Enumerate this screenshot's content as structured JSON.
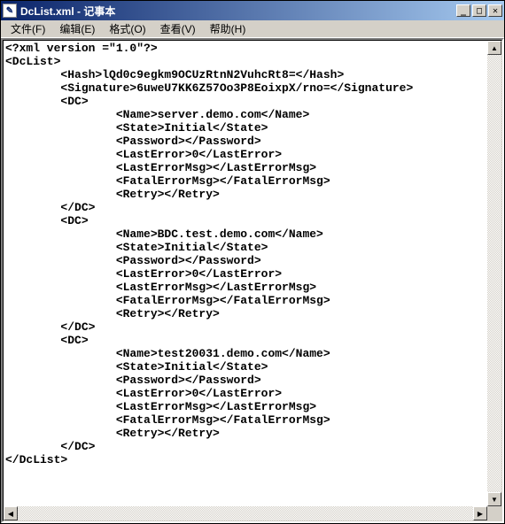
{
  "window": {
    "title": "DcList.xml - 记事本"
  },
  "menu": {
    "file": "文件(F)",
    "edit": "编辑(E)",
    "format": "格式(O)",
    "view": "查看(V)",
    "help": "帮助(H)"
  },
  "content": {
    "xml_declaration": "<?xml version =\"1.0\"?>",
    "root_open": "<DcList>",
    "hash_line": "        <Hash>lQd0c9egkm9OCUzRtnN2VuhcRt8=</Hash>",
    "sig_line": "        <Signature>6uweU7KK6Z57Oo3P8EoixpX/rno=</Signature>",
    "dc_open": "        <DC>",
    "dc_close": "        </DC>",
    "dc1_name": "                <Name>server.demo.com</Name>",
    "dc1_state": "                <State>Initial</State>",
    "dc1_password": "                <Password></Password>",
    "dc1_lasterror": "                <LastError>0</LastError>",
    "dc1_lasterrormsg": "                <LastErrorMsg></LastErrorMsg>",
    "dc1_fatalerrormsg": "                <FatalErrorMsg></FatalErrorMsg>",
    "dc1_retry": "                <Retry></Retry>",
    "dc2_name": "                <Name>BDC.test.demo.com</Name>",
    "dc2_state": "                <State>Initial</State>",
    "dc2_password": "                <Password></Password>",
    "dc2_lasterror": "                <LastError>0</LastError>",
    "dc2_lasterrormsg": "                <LastErrorMsg></LastErrorMsg>",
    "dc2_fatalerrormsg": "                <FatalErrorMsg></FatalErrorMsg>",
    "dc2_retry": "                <Retry></Retry>",
    "dc3_name": "                <Name>test20031.demo.com</Name>",
    "dc3_state": "                <State>Initial</State>",
    "dc3_password": "                <Password></Password>",
    "dc3_lasterror": "                <LastError>0</LastError>",
    "dc3_lasterrormsg": "                <LastErrorMsg></LastErrorMsg>",
    "dc3_fatalerrormsg": "                <FatalErrorMsg></FatalErrorMsg>",
    "dc3_retry": "                <Retry></Retry>",
    "root_close": "</DcList>"
  }
}
